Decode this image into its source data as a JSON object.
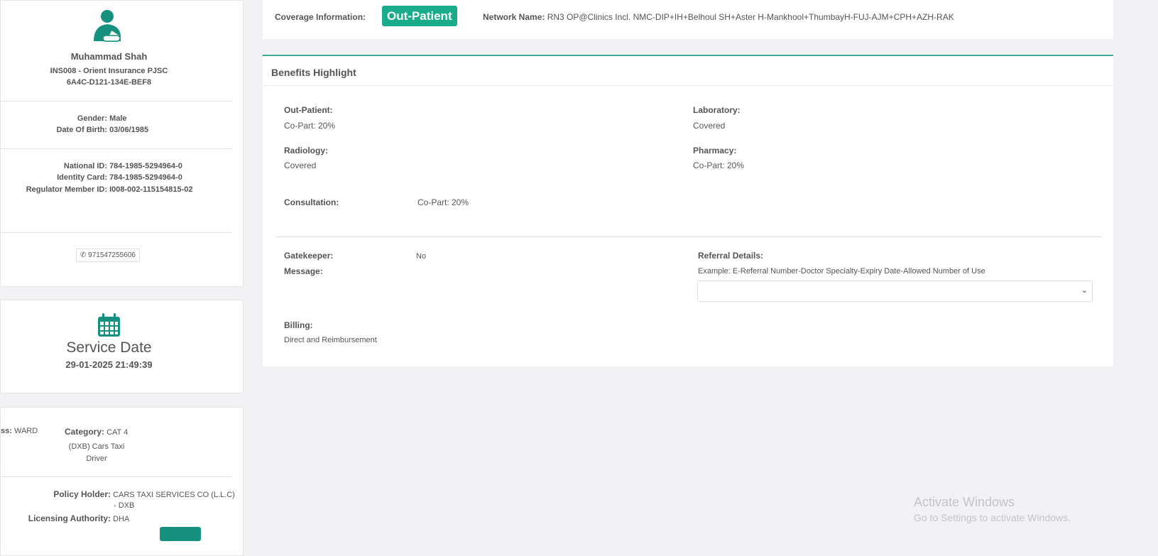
{
  "patient": {
    "name": "Muhammad Shah",
    "insurer": "INS008 - Orient Insurance PJSC",
    "card_id": "6A4C-D121-134E-BEF8",
    "gender_label": "Gender:",
    "gender": "Male",
    "dob_label": "Date Of Birth:",
    "dob": "03/06/1985",
    "national_id_label": "National ID:",
    "national_id": "784-1985-5294964-0",
    "identity_card_label": "Identity Card:",
    "identity_card": "784-1985-5294964-0",
    "regulator_label": "Regulator Member ID:",
    "regulator_id": "I008-002-115154815-02",
    "phone": "971547255606"
  },
  "service": {
    "title": "Service Date",
    "datetime": "29-01-2025 21:49:39"
  },
  "policy": {
    "class_label": "ss:",
    "class_value": "WARD",
    "category_label": "Category:",
    "category_value": "CAT 4",
    "occupation_line1": "(DXB) Cars Taxi",
    "occupation_line2": "Driver",
    "holder_label": "Policy Holder:",
    "holder_line1": "CARS TAXI SERVICES CO (L.L.C)",
    "holder_line2": "- DXB",
    "authority_label": "Licensing Authority:",
    "authority": "DHA"
  },
  "coverage": {
    "label": "Coverage Information:",
    "badge": "Out-Patient",
    "network_label": "Network Name:",
    "network": "RN3 OP@Clinics Incl. NMC-DIP+IH+Belhoul SH+Aster H-Mankhool+ThumbayH-FUJ-AJM+CPH+AZH-RAK"
  },
  "benefits": {
    "title": "Benefits Highlight",
    "outpatient_label": "Out-Patient:",
    "outpatient": "Co-Part: 20%",
    "laboratory_label": "Laboratory:",
    "laboratory": "Covered",
    "radiology_label": "Radiology:",
    "radiology": "Covered",
    "pharmacy_label": "Pharmacy:",
    "pharmacy": "Co-Part: 20%",
    "consultation_label": "Consultation:",
    "consultation": "Co-Part: 20%",
    "gatekeeper_label": "Gatekeeper:",
    "gatekeeper": "No",
    "message_label": "Message:",
    "referral_label": "Referral Details:",
    "referral_example": "Example: E-Referral Number-Doctor Specialty-Expiry Date-Allowed Number of Use",
    "billing_label": "Billing:",
    "billing": "Direct and Reimbursement"
  },
  "watermark": {
    "title": "Activate Windows",
    "subtitle": "Go to Settings to activate Windows."
  },
  "colors": {
    "accent": "#1aab8a",
    "teal": "#16917f"
  }
}
